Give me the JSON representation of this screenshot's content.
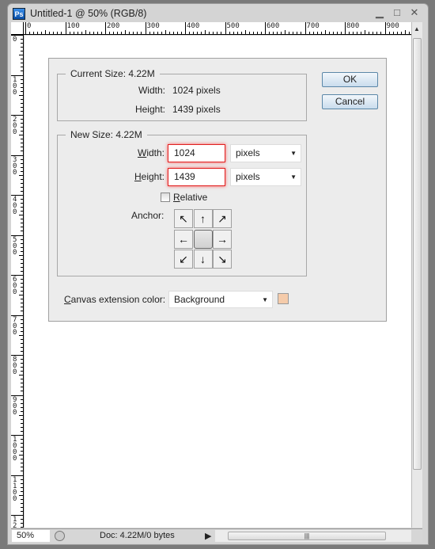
{
  "window": {
    "app_icon": "Ps",
    "title": "Untitled-1 @ 50% (RGB/8)"
  },
  "rulers": {
    "top": [
      "0",
      "100",
      "200",
      "300",
      "400",
      "500",
      "600",
      "700",
      "800",
      "900"
    ],
    "left": [
      "0",
      "100",
      "200",
      "300",
      "400",
      "500",
      "600",
      "700",
      "800",
      "900",
      "1000",
      "1100",
      "1200"
    ]
  },
  "status": {
    "zoom": "50%",
    "doc": "Doc: 4.22M/0 bytes"
  },
  "dialog": {
    "current_size": {
      "label": "Current Size: 4.22M",
      "width_label": "Width:",
      "width_value": "1024 pixels",
      "height_label": "Height:",
      "height_value": "1439 pixels"
    },
    "new_size": {
      "label": "New Size: 4.22M",
      "width_label": "Width:",
      "width_value": "1024",
      "width_unit": "pixels",
      "height_label": "Height:",
      "height_value": "1439",
      "height_unit": "pixels",
      "relative_label": "Relative",
      "relative_checked": false,
      "anchor_label": "Anchor:",
      "anchor_selected": "center"
    },
    "ok_label": "OK",
    "cancel_label": "Cancel",
    "extension": {
      "label": "Canvas extension color:",
      "value": "Background",
      "swatch_color": "#f5cbaa"
    }
  }
}
